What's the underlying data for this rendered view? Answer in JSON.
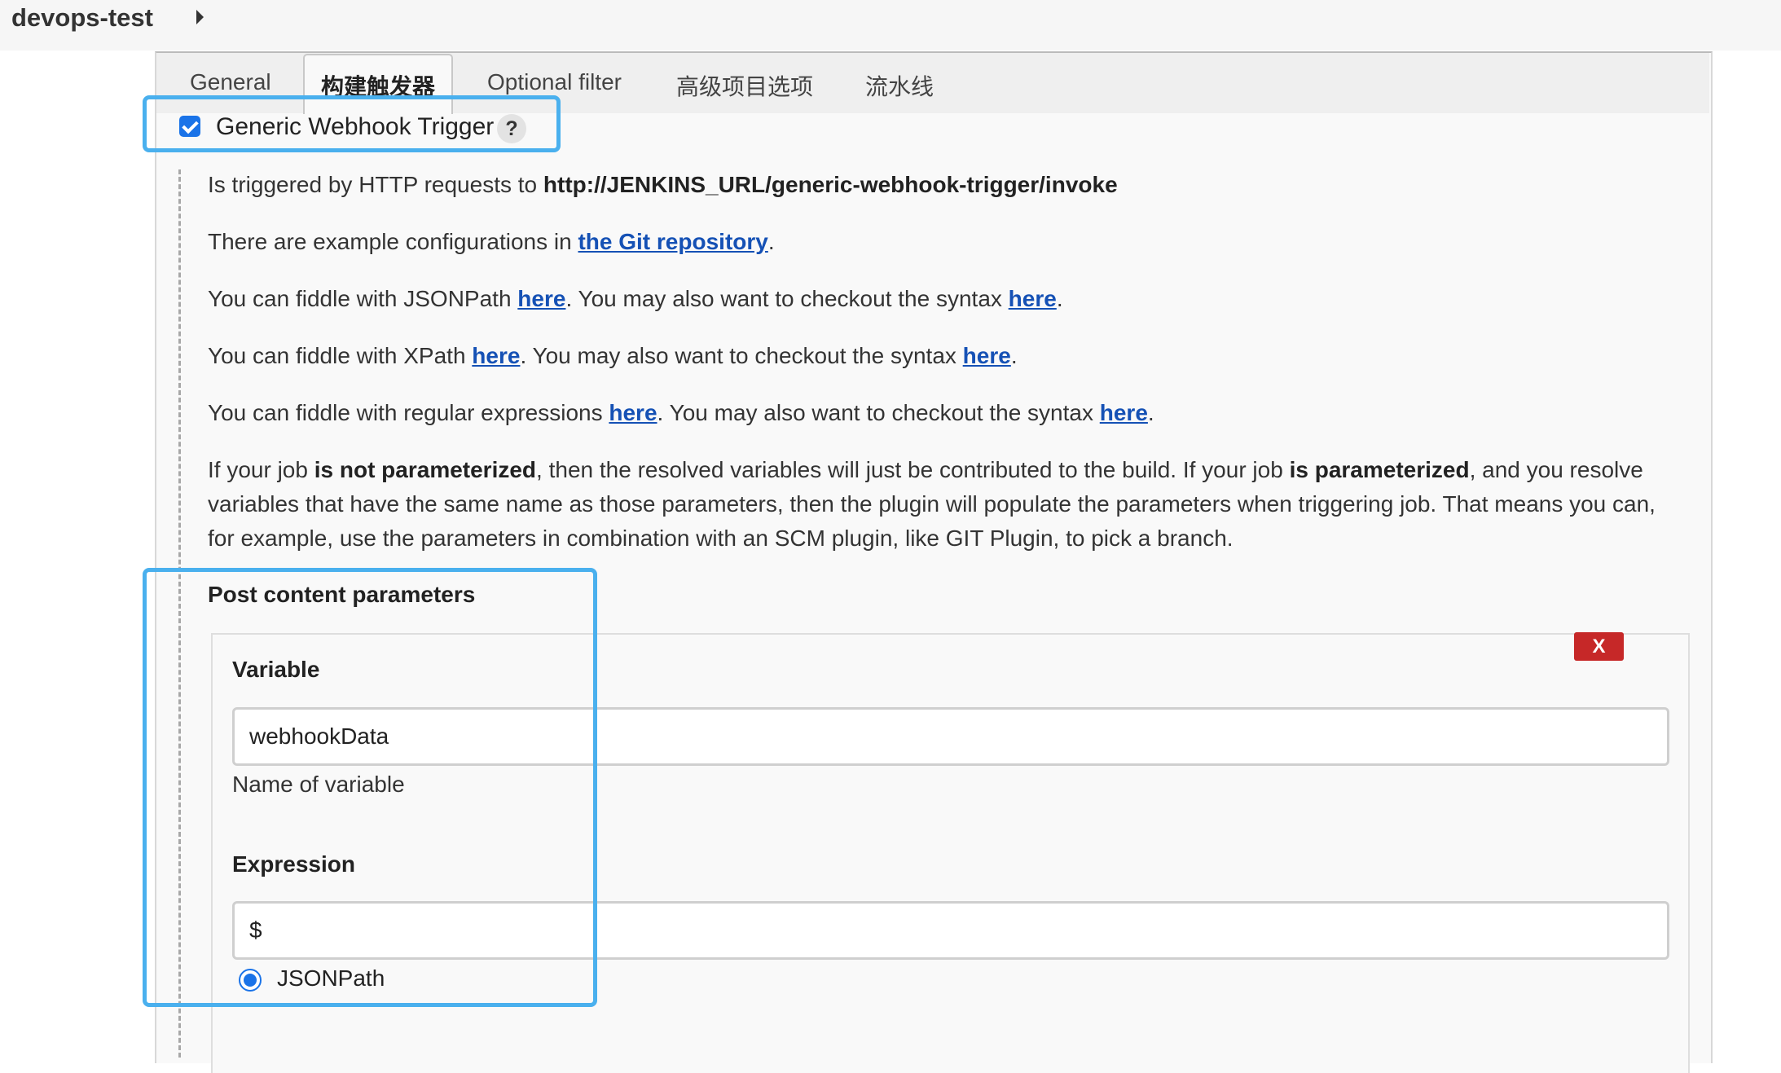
{
  "breadcrumb": {
    "project": "devops-test"
  },
  "tabs": [
    {
      "label": "General"
    },
    {
      "label": "构建触发器"
    },
    {
      "label": "Optional filter"
    },
    {
      "label": "高级项目选项"
    },
    {
      "label": "流水线"
    }
  ],
  "trigger": {
    "label": "Generic Webhook Trigger",
    "checked": true,
    "help": "?"
  },
  "description": {
    "p1_prefix": "Is triggered by HTTP requests to ",
    "p1_url": "http://JENKINS_URL/generic-webhook-trigger/invoke",
    "p2_prefix": "There are example configurations in ",
    "p2_link": "the Git repository",
    "p2_suffix": ".",
    "p3_prefix": "You can fiddle with JSONPath ",
    "p3_link1": "here",
    "p3_mid": ". You may also want to checkout the syntax ",
    "p3_link2": "here",
    "p3_suffix": ".",
    "p4_prefix": "You can fiddle with XPath ",
    "p4_link1": "here",
    "p4_mid": ". You may also want to checkout the syntax ",
    "p4_link2": "here",
    "p4_suffix": ".",
    "p5_prefix": "You can fiddle with regular expressions ",
    "p5_link1": "here",
    "p5_mid": ". You may also want to checkout the syntax ",
    "p5_link2": "here",
    "p5_suffix": ".",
    "p6_a": "If your job ",
    "p6_b": "is not parameterized",
    "p6_c": ", then the resolved variables will just be contributed to the build. If your job ",
    "p6_d": "is parameterized",
    "p6_e": ", and you resolve variables that have the same name as those parameters, then the plugin will populate the parameters when triggering job. That means you can, for example, use the parameters in combination with an SCM plugin, like GIT Plugin, to pick a branch."
  },
  "post_content": {
    "section_title": "Post content parameters",
    "delete_label": "X",
    "variable_label": "Variable",
    "variable_value": "webhookData",
    "variable_hint": "Name of variable",
    "expression_label": "Expression",
    "expression_value": "$",
    "expression_type": "JSONPath"
  },
  "colors": {
    "highlight": "#4ab0ee",
    "link": "#1551b5",
    "delete_button": "#c62828",
    "checkbox": "#1a73e8"
  }
}
